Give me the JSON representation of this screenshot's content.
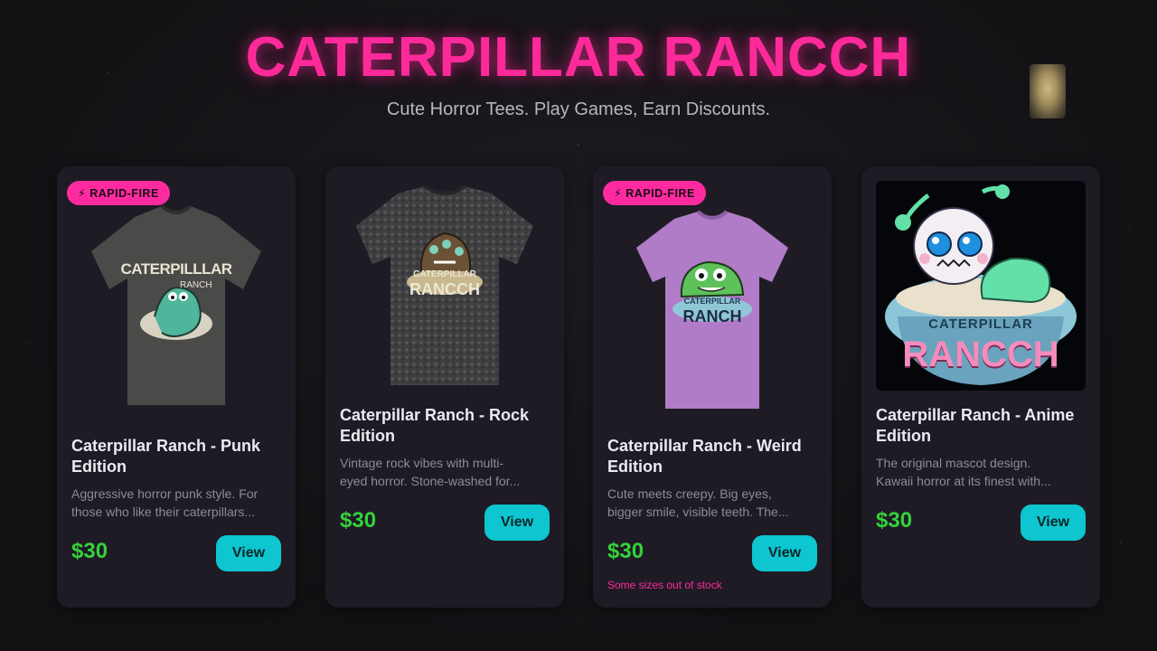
{
  "header": {
    "title": "CATERPILLAR RANCCH",
    "subtitle": "Cute Horror Tees. Play Games, Earn Discounts."
  },
  "colors": {
    "accent_pink": "#ff2a9a",
    "price_green": "#34d13a",
    "button_cyan": "#0dc6cf",
    "card_bg": "#1e1b24"
  },
  "products": [
    {
      "badge": "⚡ RAPID-FIRE",
      "name": "Caterpillar Ranch - Punk Edition",
      "desc_lines": [
        "Aggressive horror punk style. For",
        "those who like their caterpillars..."
      ],
      "price": "$30",
      "button": "View",
      "shirt_color": "#4a4a48",
      "art_text": [
        "CATERPILLLAR",
        "RANCH"
      ]
    },
    {
      "name": "Caterpillar Ranch - Rock Edition",
      "desc_lines": [
        "Vintage rock vibes with multi-",
        "eyed horror. Stone-washed for..."
      ],
      "price": "$30",
      "button": "View",
      "shirt_color": "#3f3f41",
      "art_text": [
        "CATERPILLAR",
        "RANCCH"
      ]
    },
    {
      "badge": "⚡ RAPID-FIRE",
      "name": "Caterpillar Ranch - Weird Edition",
      "desc_lines": [
        "Cute meets creepy. Big eyes,",
        "bigger smile, visible teeth. The..."
      ],
      "price": "$30",
      "button": "View",
      "stock_note": "Some sizes out of stock",
      "shirt_color": "#b07cc7",
      "art_text": [
        "CATERPILLAR",
        "RANCH"
      ]
    },
    {
      "name": "Caterpillar Ranch - Anime Edition",
      "desc_lines": [
        "The original mascot design.",
        "Kawaii horror at its finest with..."
      ],
      "price": "$30",
      "button": "View",
      "art_text": [
        "CATERPILLAR",
        "RANCCH"
      ]
    }
  ]
}
